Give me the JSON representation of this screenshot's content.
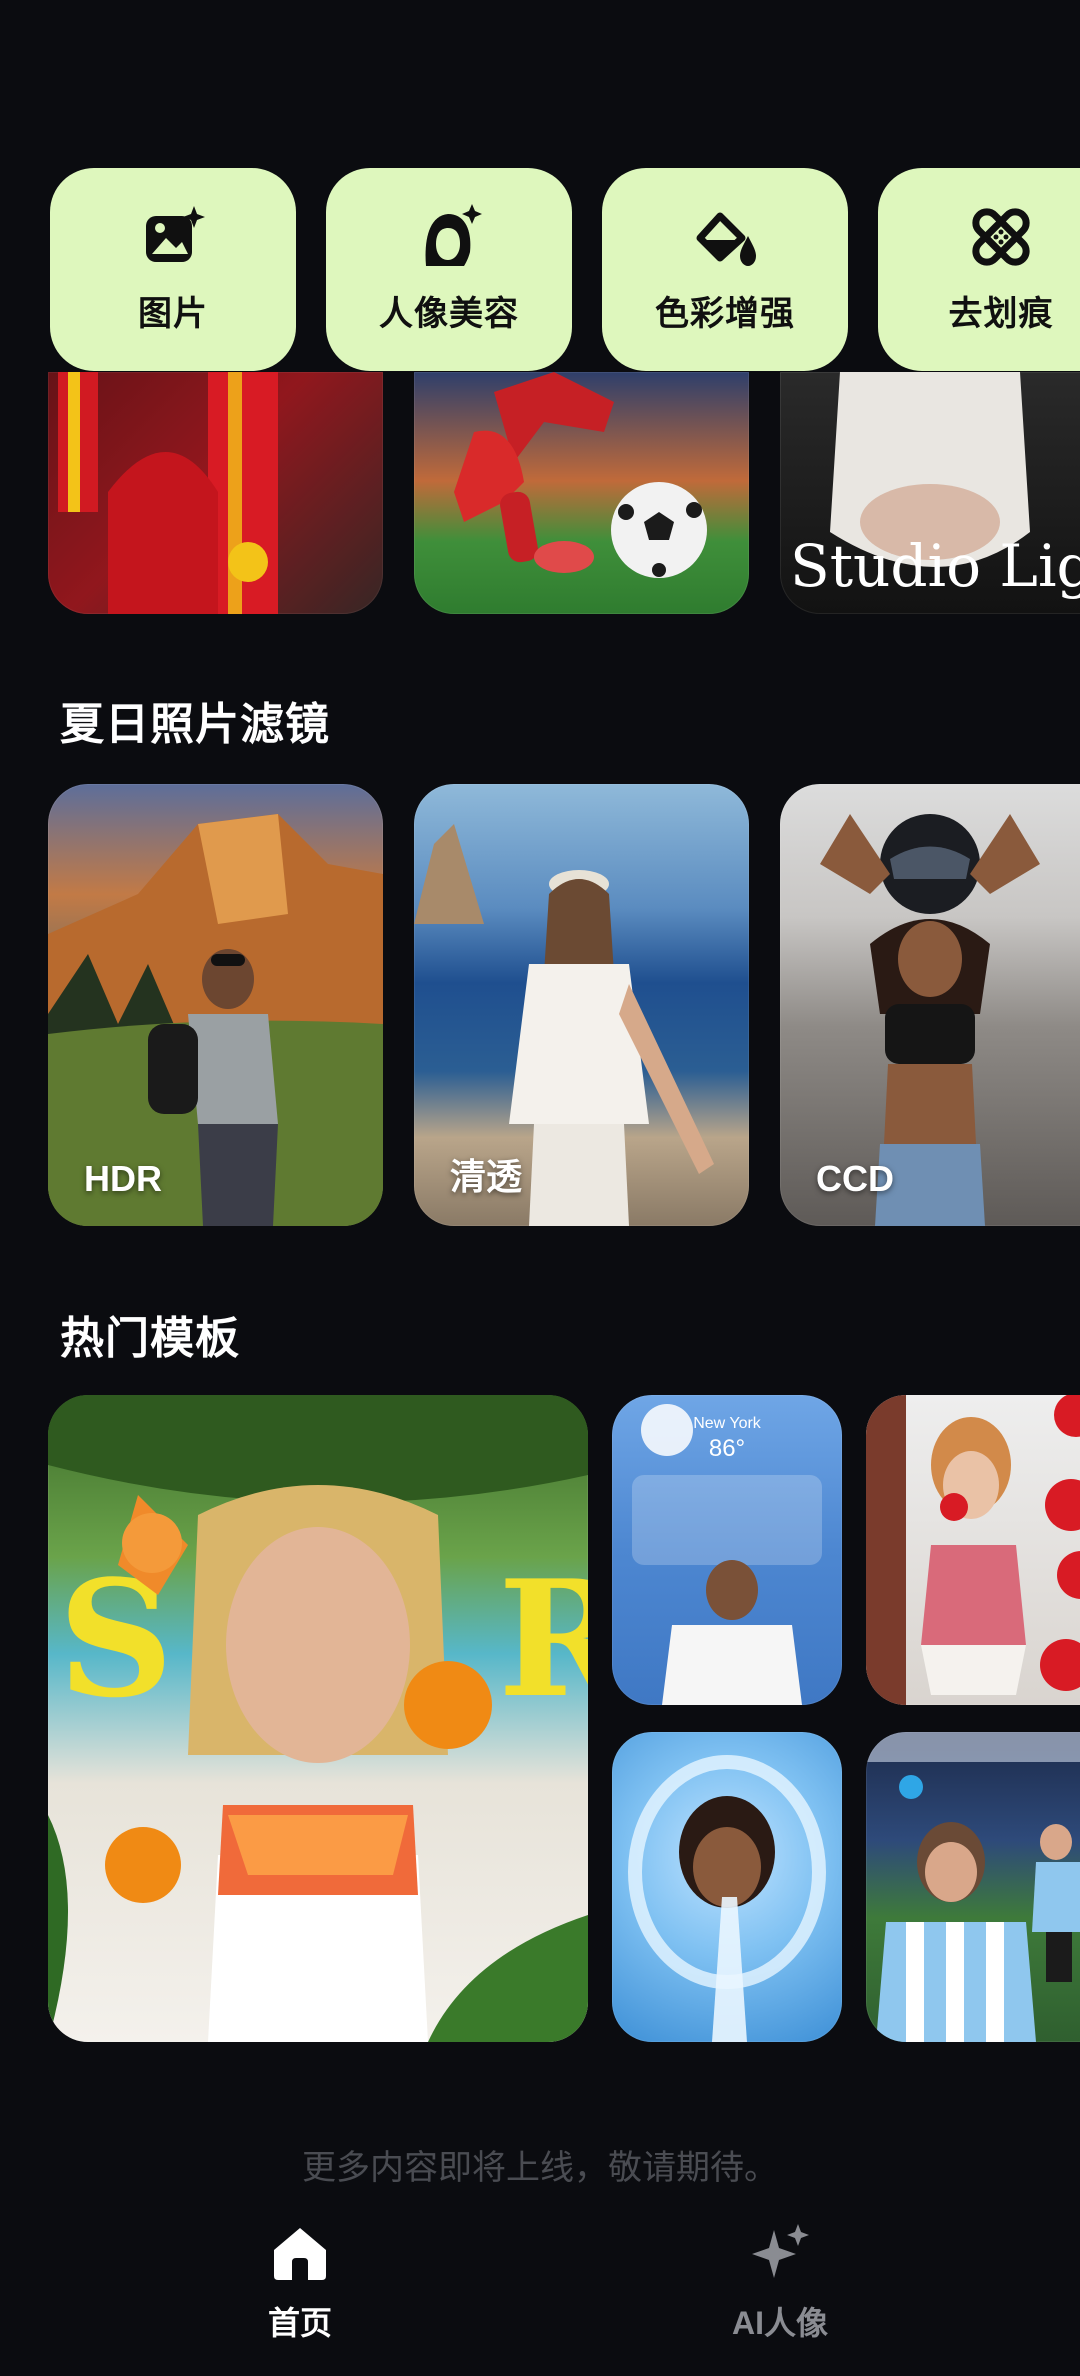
{
  "quick_actions": [
    {
      "label": "图片",
      "icon": "image-sparkle-icon"
    },
    {
      "label": "人像美容",
      "icon": "face-sparkle-icon"
    },
    {
      "label": "色彩增强",
      "icon": "color-drop-icon"
    },
    {
      "label": "去划痕",
      "icon": "bandage-icon"
    }
  ],
  "top_row": {
    "studio_text": "Studio Ligh"
  },
  "filters_section": {
    "title": "夏日照片滤镜",
    "cards": [
      {
        "label": "HDR"
      },
      {
        "label": "清透"
      },
      {
        "label": "CCD"
      }
    ]
  },
  "templates_section": {
    "title": "热门模板",
    "weather_city": "New York",
    "weather_temp": "86°"
  },
  "footer_note": "更多内容即将上线，敬请期待。",
  "bottom_nav": [
    {
      "label": "首页",
      "icon": "home-icon",
      "active": true
    },
    {
      "label": "AI人像",
      "icon": "sparkle-icon",
      "active": false
    }
  ],
  "colors": {
    "background": "#0b0c10",
    "tile": "#def7bd",
    "active_nav": "#ffffff",
    "inactive_nav": "#8a8c92"
  }
}
